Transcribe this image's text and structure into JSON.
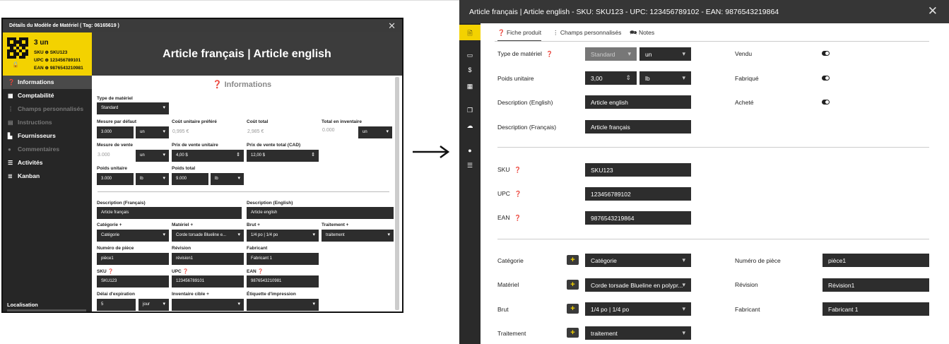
{
  "left": {
    "title": "Détails du Modèle de Matériel ( Tag: 06165619 )",
    "close": "✕",
    "badge": {
      "qty": "3 un",
      "sku": "SKU ⊕ SKU123",
      "upc": "UPC ⊕ 123456789101",
      "ean": "EAN ⊕ 9876543210981",
      "lock": "🔒"
    },
    "header": "Article français | Article english",
    "nav": [
      {
        "icon": "❓",
        "label": "Informations"
      },
      {
        "icon": "▦",
        "label": "Comptabilité"
      },
      {
        "icon": "⋮",
        "label": "Champs personnalisés"
      },
      {
        "icon": "▤",
        "label": "Instructions"
      },
      {
        "icon": "▙",
        "label": "Fournisseurs"
      },
      {
        "icon": "●",
        "label": "Commentaires"
      },
      {
        "icon": "☰",
        "label": "Activités"
      },
      {
        "icon": "≣",
        "label": "Kanban"
      }
    ],
    "localisation": {
      "label": "Localisation",
      "value": "▾"
    },
    "section_title": "❓ Informations",
    "fields": {
      "type_label": "Type de matériel",
      "type_value": "Standard",
      "mesure_label": "Mesure par défaut",
      "mesure_value": "3.000",
      "mesure_unit": "un",
      "cout_label": "Coût unitaire préféré",
      "cout_value": "0,995 €",
      "total_label": "Coût total",
      "total_value": "2,985 €",
      "inv_label": "Total en inventaire",
      "inv_value": "0.000",
      "inv_unit": "un",
      "vente_label": "Mesure de vente",
      "vente_value": "3.000",
      "vente_unit": "un",
      "prix_label": "Prix de vente unitaire",
      "prix_value": "4,00 $",
      "prixtot_label": "Prix de vente total (CAD)",
      "prixtot_value": "12,00 $",
      "poids_label": "Poids unitaire",
      "poids_value": "3.000",
      "poids_unit": "lb",
      "poidstot_label": "Poids total",
      "poidstot_value": "9.000",
      "poidstot_unit": "lb",
      "descfr_label": "Description (Français)",
      "descfr_value": "Article français",
      "descen_label": "Description (English)",
      "descen_value": "Article english",
      "cat_label": "Catégorie +",
      "cat_value": "Catégorie",
      "mat_label": "Matériel +",
      "mat_value": "Corde torsade Blueline e...",
      "brut_label": "Brut +",
      "brut_value": "1/4 po | 1/4 po",
      "trait_label": "Traitement +",
      "trait_value": "traitement",
      "num_label": "Numéro de pièce",
      "num_value": "pièce1",
      "rev_label": "Révision",
      "rev_value": "révision1",
      "fab_label": "Fabricant",
      "fab_value": "Fabricant 1",
      "sku_label": "SKU ❓",
      "sku_value": "SKU123",
      "upc_label": "UPC ❓",
      "upc_value": "123456789101",
      "ean_label": "EAN ❓",
      "ean_value": "9876543210981",
      "delai_label": "Délai d'expiration",
      "delai_value": "5",
      "delai_unit": "jour",
      "invc_label": "Inventaire cible +",
      "invc_value": "",
      "etiq_label": "Étiquette d'impression",
      "etiq_value": ""
    }
  },
  "right": {
    "title": "Article français | Article english - SKU: SKU123 - UPC: 123456789102 - EAN: 9876543219864",
    "close": "✕",
    "side_icons": [
      "🗎",
      "▭",
      "$",
      "▦",
      "❐",
      "☁",
      "●",
      "☰"
    ],
    "tabs": [
      "❓ Fiche produit",
      "⋮ Champs personnalisés",
      "🗪 Notes"
    ],
    "type_label": "Type de matériel",
    "type_value": "Standard",
    "type_unit": "un",
    "poids_label": "Poids unitaire",
    "poids_value": "3,00",
    "poids_unit": "lb",
    "descen_label": "Description (English)",
    "descen_value": "Article english",
    "descfr_label": "Description (Français)",
    "descfr_value": "Article français",
    "vendu_label": "Vendu",
    "fabrique_label": "Fabriqué",
    "achete_label": "Acheté",
    "sku_label": "SKU",
    "sku_value": "SKU123",
    "upc_label": "UPC",
    "upc_value": "123456789102",
    "ean_label": "EAN",
    "ean_value": "9876543219864",
    "q": "❓",
    "plus": "+",
    "cat_label": "Catégorie",
    "cat_value": "Catégorie",
    "mat_label": "Matériel",
    "mat_value": "Corde torsade Blueline en polypr...",
    "brut_label": "Brut",
    "brut_value": "1/4 po | 1/4 po",
    "trait_label": "Traitement",
    "trait_value": "traitement",
    "num_label": "Numéro de pièce",
    "num_value": "pièce1",
    "rev_label": "Révision",
    "rev_value": "Révision1",
    "fab_label": "Fabricant",
    "fab_value": "Fabricant 1"
  },
  "arrow": "→"
}
